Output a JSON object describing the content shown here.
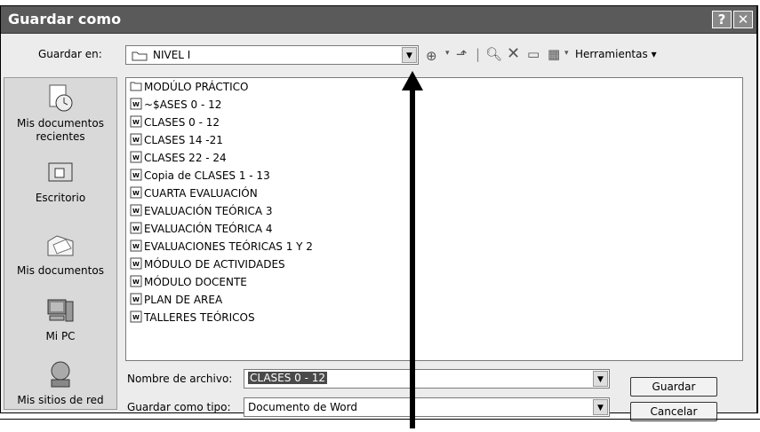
{
  "window": {
    "title": "Guardar como",
    "help_glyph": "?",
    "close_glyph": "✕"
  },
  "toolbar": {
    "save_in_label": "Guardar en:",
    "current_folder": "NIVEL I",
    "tools_label": "Herramientas"
  },
  "places": [
    {
      "label": "Mis documentos recientes",
      "icon": "recent-documents-icon"
    },
    {
      "label": "Escritorio",
      "icon": "desktop-icon"
    },
    {
      "label": "Mis documentos",
      "icon": "my-documents-icon"
    },
    {
      "label": "Mi PC",
      "icon": "my-computer-icon"
    },
    {
      "label": "Mis sitios de red",
      "icon": "network-places-icon"
    }
  ],
  "files": [
    {
      "name": "MODÚLO PRÁCTICO",
      "type": "folder"
    },
    {
      "name": "~$ASES 0 - 12",
      "type": "word"
    },
    {
      "name": "CLASES 0 - 12",
      "type": "word"
    },
    {
      "name": "CLASES 14 -21",
      "type": "word"
    },
    {
      "name": "CLASES 22 - 24",
      "type": "word"
    },
    {
      "name": "Copia de CLASES 1 - 13",
      "type": "word"
    },
    {
      "name": "CUARTA EVALUACIÓN",
      "type": "word"
    },
    {
      "name": "EVALUACIÓN TEÓRICA 3",
      "type": "word"
    },
    {
      "name": "EVALUACIÓN TEÓRICA 4",
      "type": "word"
    },
    {
      "name": "EVALUACIONES TEÓRICAS 1 Y 2",
      "type": "word"
    },
    {
      "name": "MÓDULO DE ACTIVIDADES",
      "type": "word"
    },
    {
      "name": "MÓDULO DOCENTE",
      "type": "word"
    },
    {
      "name": "PLAN DE AREA",
      "type": "word"
    },
    {
      "name": "TALLERES TEÓRICOS",
      "type": "word"
    }
  ],
  "filename": {
    "label": "Nombre de archivo:",
    "value": "CLASES 0 - 12"
  },
  "filetype": {
    "label": "Guardar como tipo:",
    "value": "Documento de Word"
  },
  "buttons": {
    "save": "Guardar",
    "cancel": "Cancelar"
  }
}
